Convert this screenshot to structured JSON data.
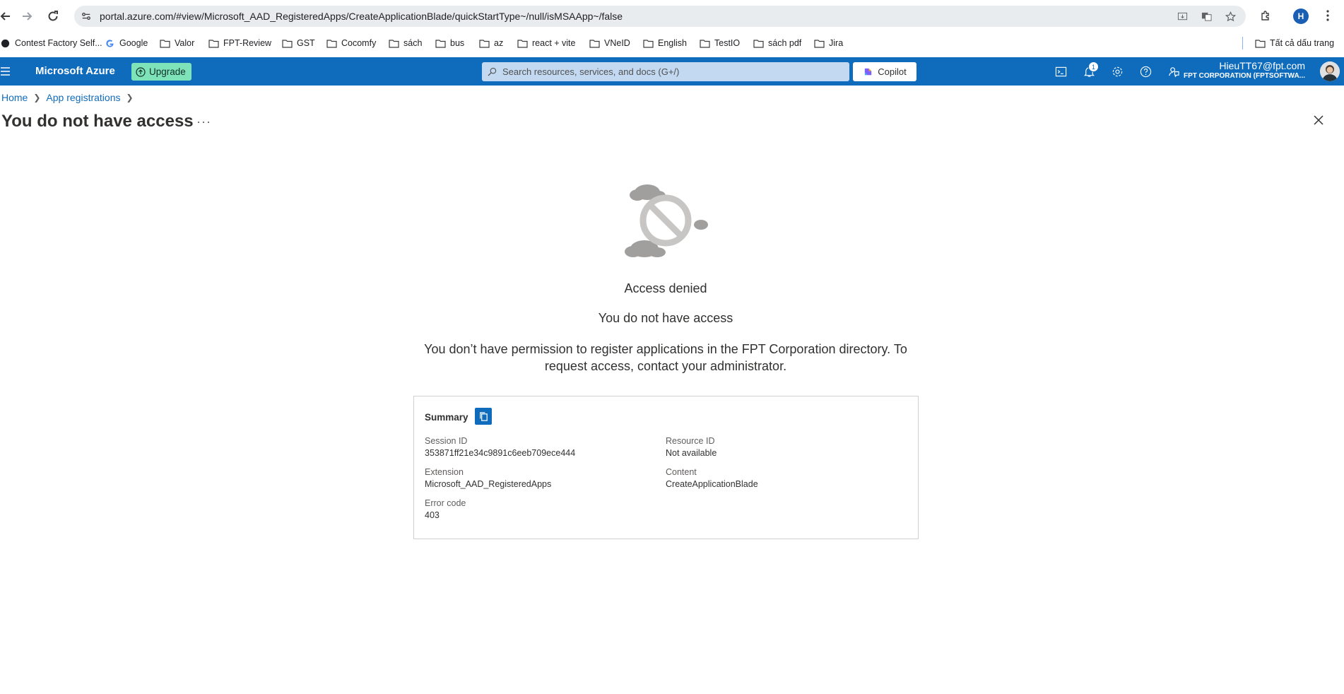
{
  "browser": {
    "url": "portal.azure.com/#view/Microsoft_AAD_RegisteredApps/CreateApplicationBlade/quickStartType~/null/isMSAApp~/false",
    "profile_initial": "H",
    "bookmarks": [
      "Contest Factory Self...",
      "Google",
      "Valor",
      "FPT-Review",
      "GST",
      "Cocomfy",
      "sách",
      "bus",
      "az",
      "react + vite",
      "VNeID",
      "English",
      "TestIO",
      "sách pdf",
      "Jira"
    ],
    "all_bookmarks_label": "Tất cả dấu trang"
  },
  "header": {
    "brand": "Microsoft Azure",
    "upgrade_label": "Upgrade",
    "search_placeholder": "Search resources, services, and docs (G+/)",
    "copilot_label": "Copilot",
    "notification_count": "1",
    "user_email": "HieuTT67@fpt.com",
    "user_org": "FPT CORPORATION (FPTSOFTWA..."
  },
  "breadcrumb": {
    "home": "Home",
    "app_registrations": "App registrations"
  },
  "page": {
    "title": "You do not have access",
    "more_label": "···"
  },
  "error": {
    "heading": "Access denied",
    "subheading": "You do not have access",
    "description": "You don’t have permission to register applications in the FPT Corporation directory. To request access, contact your administrator."
  },
  "summary": {
    "title": "Summary",
    "session_id_label": "Session ID",
    "session_id": "353871ff21e34c9891c6eeb709ece444",
    "resource_id_label": "Resource ID",
    "resource_id": "Not available",
    "extension_label": "Extension",
    "extension": "Microsoft_AAD_RegisteredApps",
    "content_label": "Content",
    "content": "CreateApplicationBlade",
    "error_code_label": "Error code",
    "error_code": "403"
  },
  "colors": {
    "azure_blue": "#0f6cbd",
    "upgrade_green": "#7ee3b9"
  }
}
